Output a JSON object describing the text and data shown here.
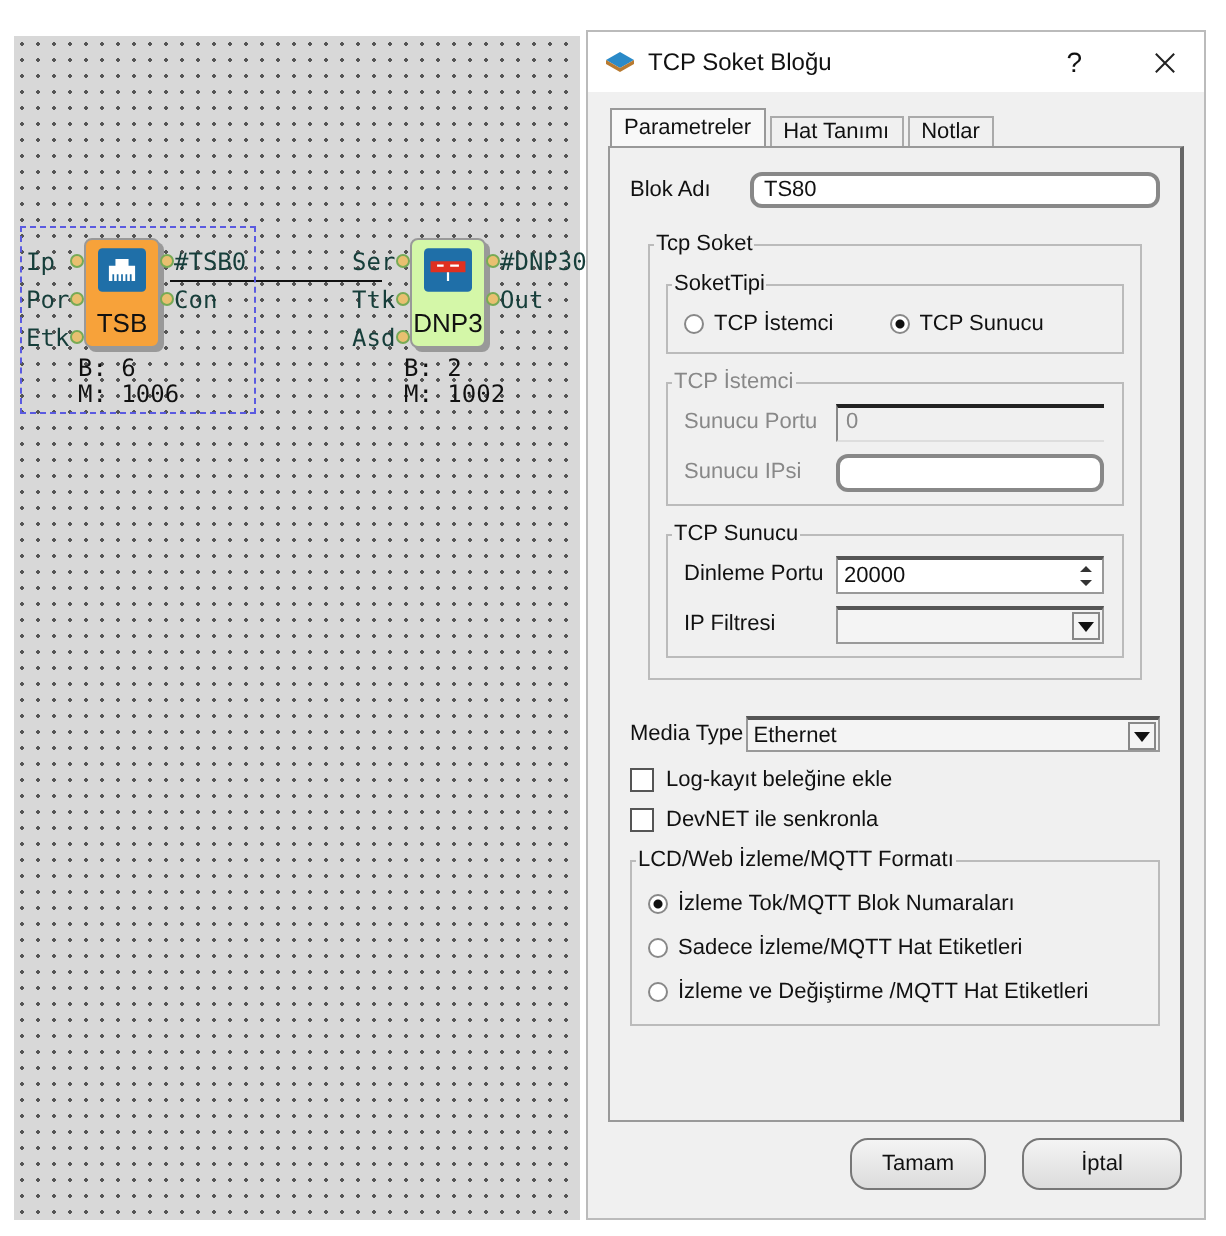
{
  "canvas": {
    "blocks": [
      {
        "name": "TSB",
        "kind": "socket",
        "selected": true,
        "inputs": [
          "Ip",
          "Por",
          "Etk"
        ],
        "outputs": [
          "#TSB0",
          "Con"
        ],
        "b": "B: 6",
        "m": "M: 1006"
      },
      {
        "name": "DNP3",
        "kind": "dnp",
        "selected": false,
        "inputs": [
          "Ser",
          "Ttk",
          "Asd"
        ],
        "outputs": [
          "#DNP30",
          "Out"
        ],
        "b": "B: 2",
        "m": "M: 1002"
      }
    ]
  },
  "dialog": {
    "title": "TCP Soket Bloğu",
    "help": "?",
    "tabs": [
      {
        "label": "Parametreler",
        "selected": true
      },
      {
        "label": "Hat Tanımı",
        "selected": false
      },
      {
        "label": "Notlar",
        "selected": false
      }
    ],
    "block_name": {
      "label": "Blok Adı",
      "value": "TS80"
    },
    "tcp_socket": {
      "title": "Tcp Soket",
      "socket_type": {
        "title": "SoketTipi",
        "options": [
          {
            "label": "TCP İstemci",
            "selected": false
          },
          {
            "label": "TCP Sunucu",
            "selected": true
          }
        ]
      },
      "client": {
        "title": "TCP İstemci",
        "disabled": true,
        "fields": [
          {
            "label": "Sunucu Portu",
            "kind": "text",
            "value": "0",
            "disabled": true
          },
          {
            "label": "Sunucu IPsi",
            "kind": "text",
            "disabled": false
          }
        ]
      },
      "server": {
        "title": "TCP Sunucu",
        "disabled": false,
        "fields": [
          {
            "label": "Dinleme Portu",
            "kind": "spin",
            "value": "20000"
          },
          {
            "label": "IP Filtresi",
            "kind": "combo"
          }
        ]
      }
    },
    "media_type": {
      "label": "Media Type",
      "value": "Ethernet"
    },
    "checkboxes": [
      {
        "label": "Log-kayıt beleğine ekle",
        "checked": false
      },
      {
        "label": "DevNET ile senkronla",
        "checked": false
      }
    ],
    "format": {
      "title": "LCD/Web İzleme/MQTT Formatı",
      "options": [
        {
          "label": "İzleme Tok/MQTT Blok Numaraları",
          "selected": true
        },
        {
          "label": "Sadece İzleme/MQTT Hat Etiketleri",
          "selected": false
        },
        {
          "label": "İzleme ve Değiştirme /MQTT Hat Etiketleri",
          "selected": false
        }
      ]
    },
    "buttons": [
      "Tamam",
      "İptal"
    ]
  }
}
